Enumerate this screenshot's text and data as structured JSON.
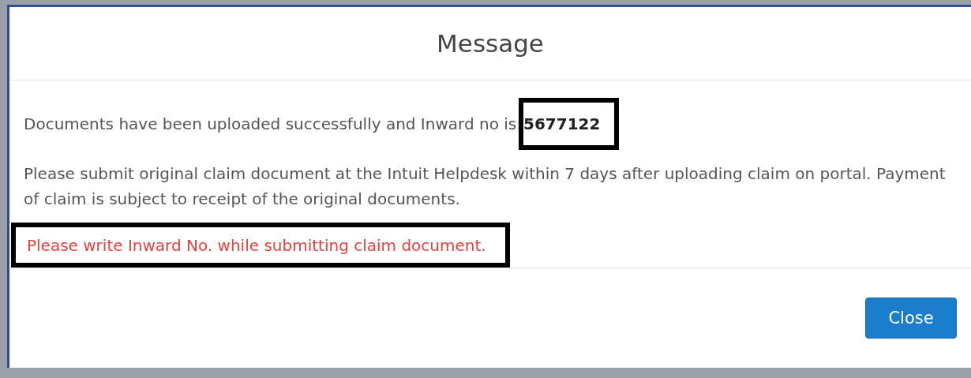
{
  "dialog": {
    "title": "Message",
    "messages": [
      {
        "kind": "plain",
        "text": "Documents have been uploaded successfully and Inward no is:",
        "value": "5677122",
        "highlighted": true
      },
      {
        "kind": "plain",
        "text": "Please submit original claim document at the Intuit Helpdesk within 7 days after uploading claim on portal. Payment of claim is subject to receipt of the original documents.",
        "highlighted": false
      },
      {
        "kind": "warning",
        "text": "Please write Inward No. while submitting claim document.",
        "highlighted": true
      }
    ],
    "buttons": [
      {
        "label": "Close"
      }
    ]
  }
}
